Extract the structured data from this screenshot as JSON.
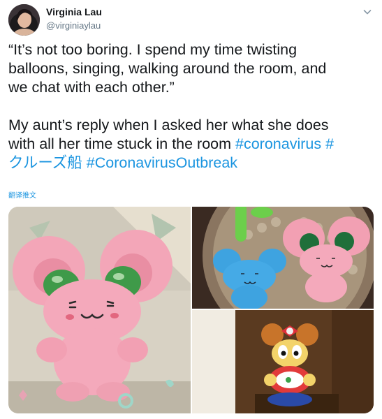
{
  "author": {
    "name": "Virginia Lau",
    "handle": "@virginiaylau"
  },
  "tweet": {
    "quote_lines": [
      "“It’s not too boring. I spend my time twisting",
      "balloons, singing, walking around the room, and",
      "we chat with each other.”"
    ],
    "reply_line1": "My aunt’s reply when I asked her what she does",
    "reply_line2_text": "with all her time stuck in the room ",
    "hashtag1": "#coronavirus",
    "hashtag2_part1": " #",
    "hashtag2_part2": "クルーズ船",
    "hashtag3": " #CoronavirusOutbreak",
    "translate_label": "翻译推文"
  },
  "icons": {
    "menu": "chevron-down-icon"
  },
  "colors": {
    "text": "#14171a",
    "secondary": "#657786",
    "link": "#1b95e0"
  },
  "media": [
    {
      "description_key": "pink-balloon-mouse"
    },
    {
      "description_key": "blue-and-pink-balloon-mice"
    },
    {
      "description_key": "balloon-minnie-figure"
    }
  ]
}
